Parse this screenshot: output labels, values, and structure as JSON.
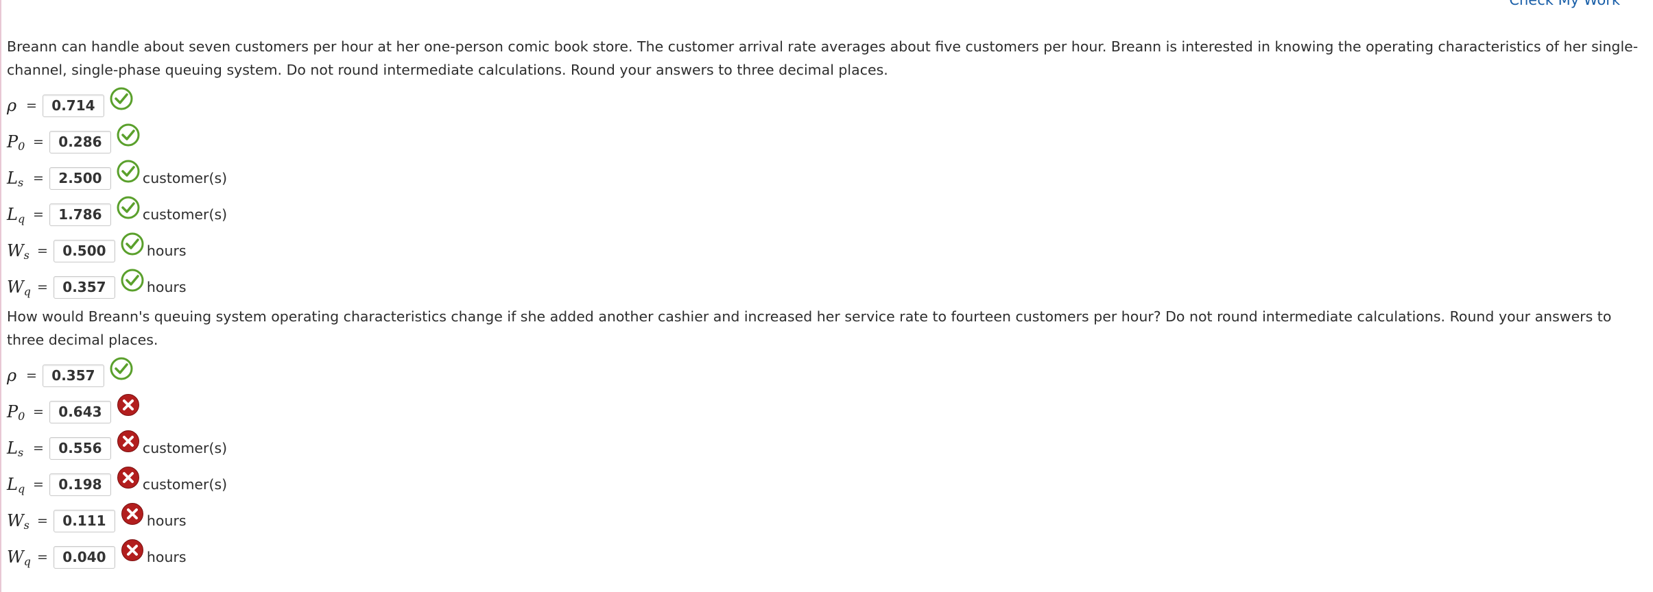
{
  "header": {
    "check_link_label": "Check My Work"
  },
  "colors": {
    "correct": "#5aa02c",
    "incorrect": "#b21e1e",
    "link": "#1a5fa8"
  },
  "part1": {
    "prompt": "Breann can handle about seven customers per hour at her one-person comic book store. The customer arrival rate averages about five customers per hour. Breann is interested in knowing the operating characteristics of her single-channel, single-phase queuing system. Do not round intermediate calculations. Round your answers to three decimal places.",
    "rows": [
      {
        "symbol": "ρ",
        "sub": "",
        "eq": "=",
        "value": "0.714",
        "status": "correct",
        "unit": ""
      },
      {
        "symbol": "P",
        "sub": "0",
        "eq": "=",
        "value": "0.286",
        "status": "correct",
        "unit": ""
      },
      {
        "symbol": "L",
        "sub": "s",
        "eq": "=",
        "value": "2.500",
        "status": "correct",
        "unit": "customer(s)"
      },
      {
        "symbol": "L",
        "sub": "q",
        "eq": "=",
        "value": "1.786",
        "status": "correct",
        "unit": "customer(s)"
      },
      {
        "symbol": "W",
        "sub": "s",
        "eq": "=",
        "value": "0.500",
        "status": "correct",
        "unit": "hours"
      },
      {
        "symbol": "W",
        "sub": "q",
        "eq": "=",
        "value": "0.357",
        "status": "correct",
        "unit": "hours"
      }
    ]
  },
  "part2": {
    "prompt": "How would Breann's queuing system operating characteristics change if she added another cashier and increased her service rate to fourteen customers per hour? Do not round intermediate calculations. Round your answers to three decimal places.",
    "rows": [
      {
        "symbol": "ρ",
        "sub": "",
        "eq": "=",
        "value": "0.357",
        "status": "correct",
        "unit": ""
      },
      {
        "symbol": "P",
        "sub": "0",
        "eq": "=",
        "value": "0.643",
        "status": "incorrect",
        "unit": ""
      },
      {
        "symbol": "L",
        "sub": "s",
        "eq": "=",
        "value": "0.556",
        "status": "incorrect",
        "unit": "customer(s)"
      },
      {
        "symbol": "L",
        "sub": "q",
        "eq": "=",
        "value": "0.198",
        "status": "incorrect",
        "unit": "customer(s)"
      },
      {
        "symbol": "W",
        "sub": "s",
        "eq": "=",
        "value": "0.111",
        "status": "incorrect",
        "unit": "hours"
      },
      {
        "symbol": "W",
        "sub": "q",
        "eq": "=",
        "value": "0.040",
        "status": "incorrect",
        "unit": "hours"
      }
    ]
  }
}
